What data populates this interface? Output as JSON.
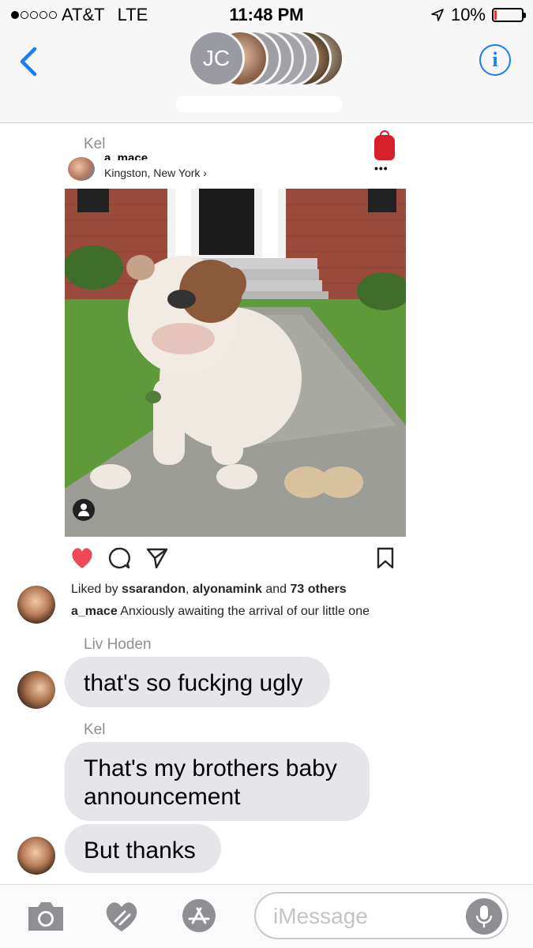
{
  "status_bar": {
    "carrier": "AT&T",
    "network": "LTE",
    "time": "11:48 PM",
    "battery": "10%",
    "battery_level": 0.1,
    "signal_dots_filled": 1,
    "signal_dots_total": 5
  },
  "header": {
    "group_initials": "JC",
    "accent_color": "#1a7cf5"
  },
  "messages": [
    {
      "sender": "Kel",
      "type": "shared-instagram-post"
    },
    {
      "sender": "Liv Hoden",
      "text": "that's so fuckjng ugly"
    },
    {
      "sender": "Kel",
      "text": "That's my brothers baby announcement"
    },
    {
      "sender": "",
      "text": "But thanks"
    }
  ],
  "post": {
    "username": "a_mace",
    "location": "Kingston, New York ›",
    "liked_by_prefix": "Liked by ",
    "liked_user1": "ssarandon",
    "liked_sep": ", ",
    "liked_user2": "alyonamink",
    "liked_and": " and ",
    "liked_others": "73 others",
    "caption_user": "a_mace",
    "caption_text": " Anxiously awaiting the arrival of our little one",
    "heart_color": "#ed4956"
  },
  "input_bar": {
    "placeholder": "iMessage"
  },
  "icons": [
    "back-chevron-icon",
    "info-icon",
    "camera-icon",
    "digital-touch-heart-icon",
    "app-store-icon",
    "microphone-icon",
    "heart-icon",
    "comment-icon",
    "share-icon",
    "bookmark-icon",
    "backpack-icon",
    "more-icon",
    "person-tag-icon"
  ]
}
